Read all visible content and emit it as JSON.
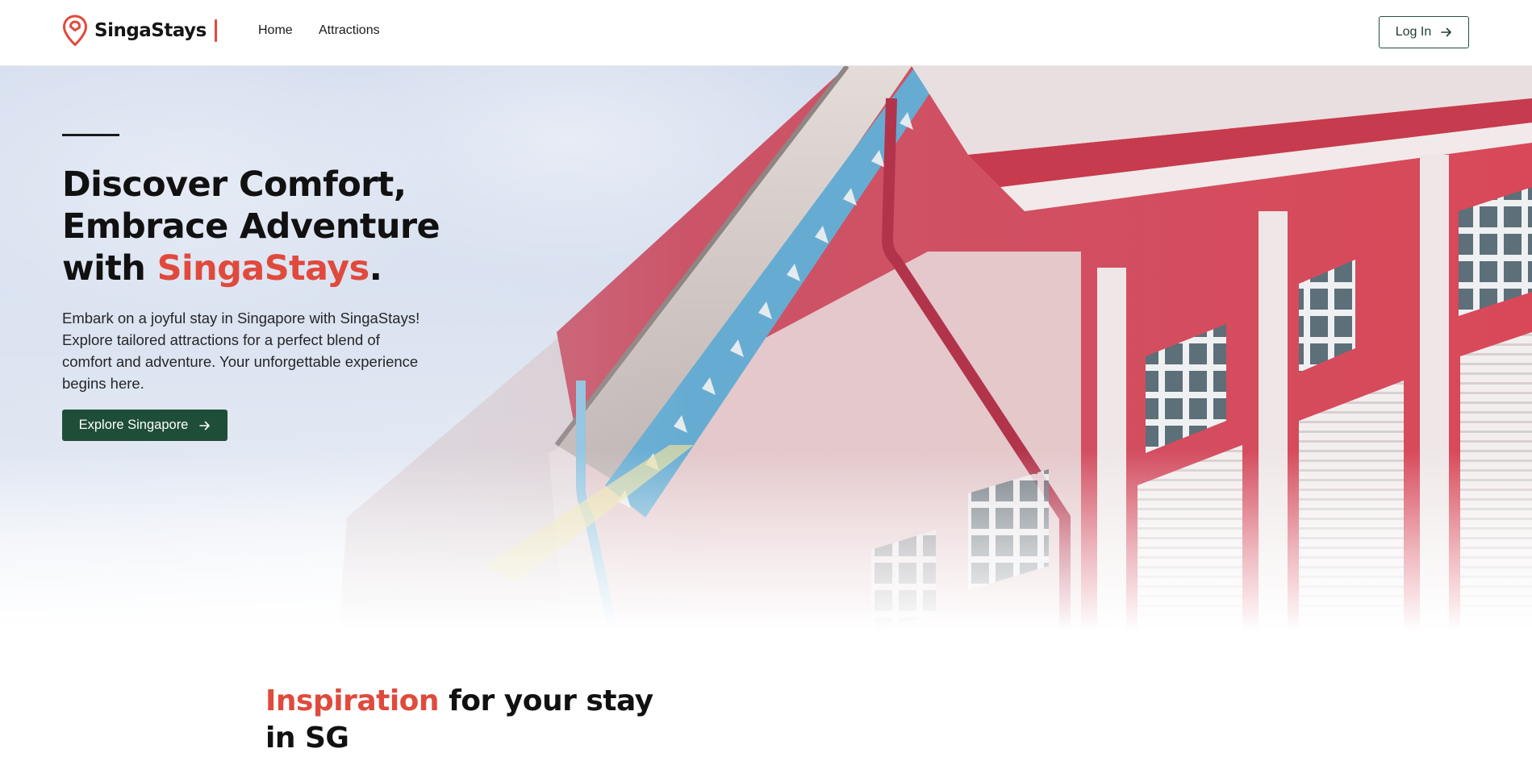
{
  "navbar": {
    "brand_name": "SingaStays",
    "links": [
      {
        "label": "Home"
      },
      {
        "label": "Attractions"
      }
    ],
    "login_label": "Log In"
  },
  "hero": {
    "title_line1": "Discover Comfort,",
    "title_line2": "Embrace Adventure",
    "title_line3_prefix": "with ",
    "title_line3_accent": "SingaStays",
    "title_line3_suffix": ".",
    "description": "Embark on a joyful stay in Singapore with SingaStays! Explore tailored attractions for a perfect blend of comfort and adventure. Your unforgettable experience begins here.",
    "cta_label": "Explore Singapore"
  },
  "inspiration": {
    "title_accent": "Inspiration",
    "title_rest": " for your stay in SG"
  },
  "colors": {
    "accent": "#e04a3c",
    "primary_green": "#1f4e38",
    "text_dark": "#111111"
  },
  "icons": {
    "brand_logo": "location-pin-icon",
    "login_arrow": "arrow-right-icon",
    "cta_arrow": "arrow-right-icon"
  }
}
